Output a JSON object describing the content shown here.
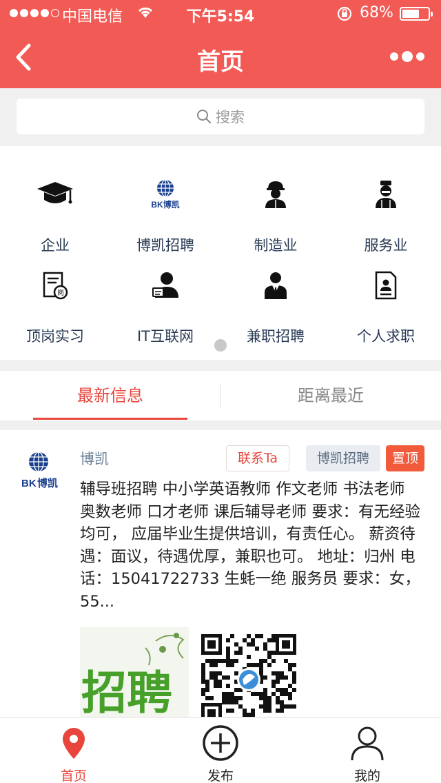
{
  "status_bar": {
    "carrier": "中国电信",
    "time": "下午5:54",
    "battery_pct": "68%",
    "battery_level": 0.68,
    "signal_bars_filled": 4,
    "signal_bars_total": 5
  },
  "header": {
    "title": "首页",
    "back_icon": "chevron-left-icon",
    "more_icon": "more-dots-icon"
  },
  "search": {
    "placeholder": "搜索"
  },
  "categories": [
    {
      "label": "企业",
      "icon": "graduation-cap-icon"
    },
    {
      "label": "博凯招聘",
      "icon": "bokai-logo-icon"
    },
    {
      "label": "制造业",
      "icon": "worker-icon"
    },
    {
      "label": "服务业",
      "icon": "nurse-icon"
    },
    {
      "label": "顶岗实习",
      "icon": "internship-doc-icon"
    },
    {
      "label": "IT互联网",
      "icon": "it-person-icon"
    },
    {
      "label": "兼职招聘",
      "icon": "suit-person-icon"
    },
    {
      "label": "个人求职",
      "icon": "resume-icon"
    }
  ],
  "tabs": [
    {
      "label": "最新信息",
      "active": true
    },
    {
      "label": "距离最近",
      "active": false
    }
  ],
  "post": {
    "author": "博凯",
    "contact_label": "联系Ta",
    "category_tag": "博凯招聘",
    "top_tag": "置顶",
    "text": "辅导班招聘 中小学英语教师 作文老师 书法老师 奥数老师 口才老师 课后辅导老师 要求：有无经验均可， 应届毕业生提供培训，有责任心。 薪资待遇：面议，待遇优厚，兼职也可。 地址：归州 电话：15041722733 生蚝一绝   服务员 要求：女，55...",
    "logo_text": "博凯",
    "thumb_text": "招聘"
  },
  "bottom_nav": [
    {
      "label": "首页",
      "icon": "location-pin-icon",
      "active": true
    },
    {
      "label": "发布",
      "icon": "plus-circle-icon",
      "active": false
    },
    {
      "label": "我的",
      "icon": "user-icon",
      "active": false
    }
  ],
  "colors": {
    "brand": "#f25a55",
    "accent": "#e8453c",
    "top_tag": "#f25a3c"
  }
}
